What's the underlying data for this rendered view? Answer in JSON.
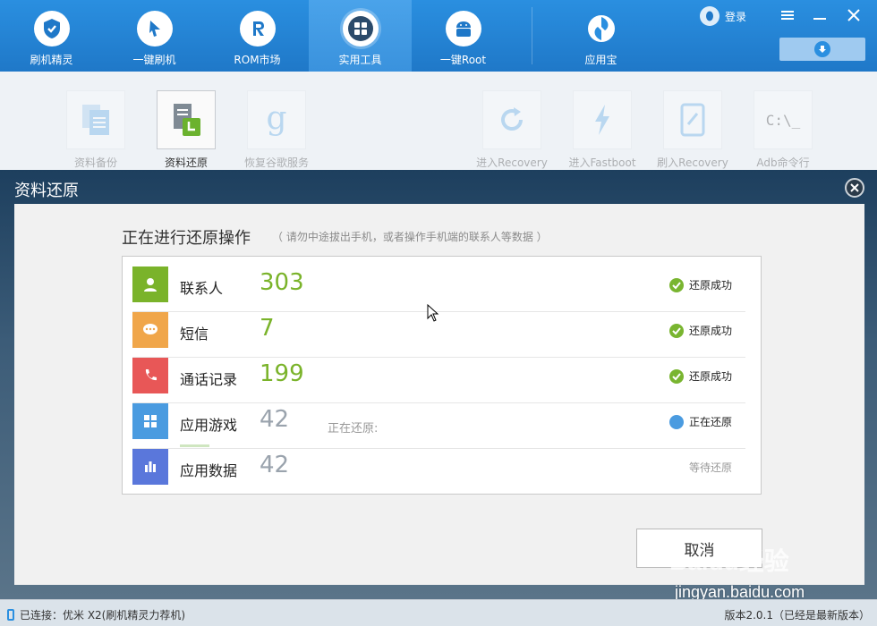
{
  "nav": {
    "items": [
      {
        "label": "刷机精灵"
      },
      {
        "label": "一键刷机"
      },
      {
        "label": "ROM市场"
      },
      {
        "label": "实用工具"
      },
      {
        "label": "一键Root"
      },
      {
        "label": "应用宝"
      }
    ],
    "login_label": "登录"
  },
  "tools": {
    "items": [
      {
        "label": "资料备份"
      },
      {
        "label": "资料还原"
      },
      {
        "label": "恢复谷歌服务"
      },
      {
        "label": "进入Recovery"
      },
      {
        "label": "进入Fastboot"
      },
      {
        "label": "刷入Recovery"
      },
      {
        "label": "Adb命令行"
      }
    ],
    "adb_glyph": "C:\\_"
  },
  "dialog": {
    "title": "资料还原",
    "op_title": "正在进行还原操作",
    "op_hint": "（ 请勿中途拔出手机，或者操作手机端的联系人等数据 ）",
    "cancel_label": "取消"
  },
  "rows": [
    {
      "name": "联系人",
      "count": "303",
      "status": "还原成功",
      "icon": "contact-icon",
      "color": "#7ab32a"
    },
    {
      "name": "短信",
      "count": "7",
      "status": "还原成功",
      "icon": "sms-icon",
      "color": "#f0a64a"
    },
    {
      "name": "通话记录",
      "count": "199",
      "status": "还原成功",
      "icon": "phone-icon",
      "color": "#e85757"
    },
    {
      "name": "应用游戏",
      "count": "42",
      "progress_label": "正在还原:",
      "status": "正在还原",
      "icon": "apps-icon",
      "color": "#4a9be0"
    },
    {
      "name": "应用数据",
      "count": "42",
      "status": "等待还原",
      "icon": "data-icon",
      "color": "#5a77db"
    }
  ],
  "status_bar": {
    "connection": "已连接：优米 X2(刷机精灵力荐机)",
    "version": "版本2.0.1（已经是最新版本）"
  },
  "watermark": {
    "brand": "Baidu经验",
    "url": "jingyan.baidu.com"
  }
}
